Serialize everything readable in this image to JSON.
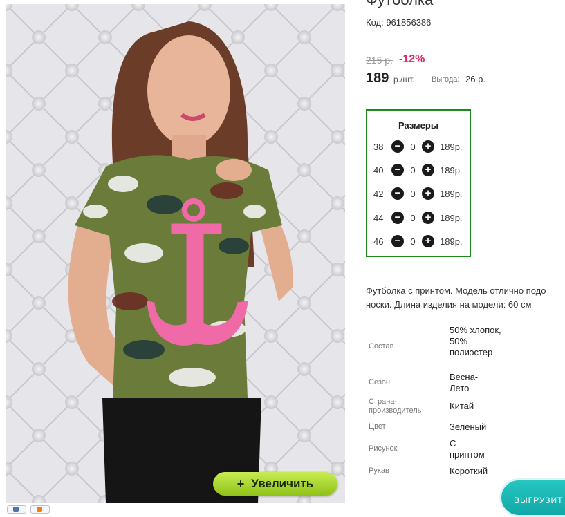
{
  "product": {
    "title": "Футболка",
    "code_text": "Код: 961856386",
    "old_price": "215 р.",
    "discount": "-12%",
    "price": "189",
    "unit": "р./шт.",
    "savings_label": "Выгода:",
    "savings_value": "26 р."
  },
  "sizes": {
    "title": "Размеры",
    "rows": [
      {
        "size": "38",
        "qty": "0",
        "price": "189р."
      },
      {
        "size": "40",
        "qty": "0",
        "price": "189р."
      },
      {
        "size": "42",
        "qty": "0",
        "price": "189р."
      },
      {
        "size": "44",
        "qty": "0",
        "price": "189р."
      },
      {
        "size": "46",
        "qty": "0",
        "price": "189р."
      }
    ],
    "minus_glyph": "−",
    "plus_glyph": "+"
  },
  "description": {
    "line1": "Футболка с принтом. Модель отлично подо",
    "line2": "носки. Длина изделия на модели: 60 см"
  },
  "attributes": [
    {
      "label": "Состав",
      "value": "50% хлопок, 50% полиэстер"
    },
    {
      "label": "Сезон",
      "value": "Весна-Лето"
    },
    {
      "label": "Страна-производитель",
      "value": "Китай"
    },
    {
      "label": "Цвет",
      "value": "Зеленый"
    },
    {
      "label": "Рисунок",
      "value": "С принтом"
    },
    {
      "label": "Рукав",
      "value": "Короткий"
    }
  ],
  "zoom_button": {
    "plus": "+",
    "label": "Увеличить"
  },
  "export_button": {
    "label": "ВЫГРУЗИТ"
  },
  "icons": {
    "zoom": "plus-icon",
    "minus": "minus-circle-icon",
    "plus": "plus-circle-icon",
    "share": "social-share-icon"
  },
  "colors": {
    "discount": "#e0245e",
    "sizes_border": "#1c8a1c",
    "zoom_button": "#9fd12a",
    "export_button": "#17b3b1"
  }
}
